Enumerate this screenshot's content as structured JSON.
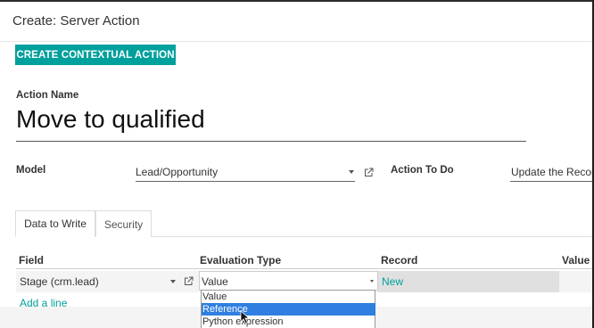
{
  "dialog": {
    "title": "Create: Server Action"
  },
  "toolbar": {
    "contextual_action_label": "CREATE CONTEXTUAL ACTION"
  },
  "form": {
    "action_name_label": "Action Name",
    "action_name_value": "Move to qualified",
    "model_label": "Model",
    "model_value": "Lead/Opportunity",
    "action_to_do_label": "Action To Do",
    "action_to_do_value": "Update the Record"
  },
  "tabs": [
    {
      "label": "Data to Write",
      "active": true
    },
    {
      "label": "Security",
      "active": false
    }
  ],
  "table": {
    "columns": [
      "Field",
      "Evaluation Type",
      "Record",
      "Value"
    ],
    "rows": [
      {
        "field": "Stage (crm.lead)",
        "evaluation_type": "Value",
        "record": "New",
        "value": ""
      }
    ],
    "add_line_label": "Add a line"
  },
  "dropdown": {
    "options": [
      "Value",
      "Reference",
      "Python expression"
    ],
    "highlighted": "Reference"
  },
  "colors": {
    "accent": "#00a09d",
    "selection": "#2f7fe0"
  },
  "icons": [
    "external-link-icon",
    "chevron-down-icon",
    "mouse-cursor-icon"
  ]
}
